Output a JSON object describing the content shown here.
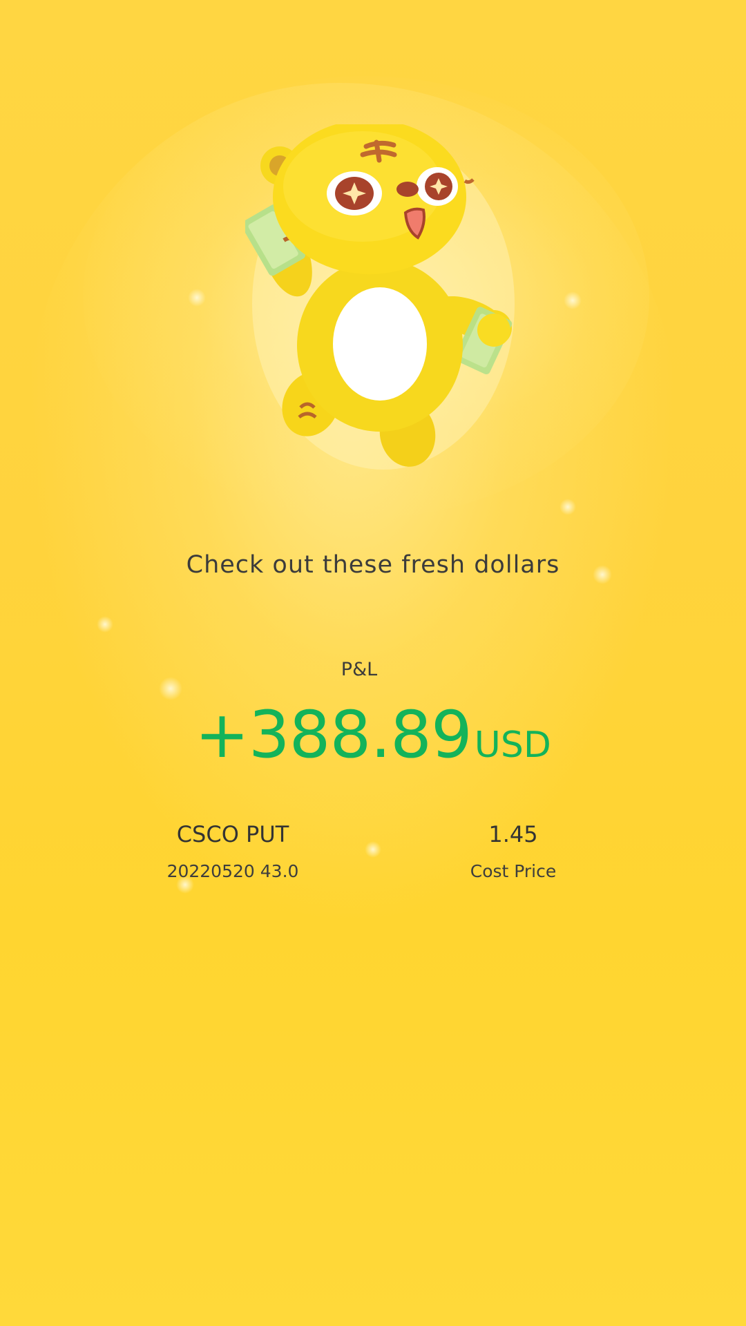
{
  "headline": "Check out these fresh dollars",
  "pnl": {
    "label": "P&L",
    "value": "+388.89",
    "unit": "USD"
  },
  "position": {
    "symbol": "CSCO PUT",
    "contract": "20220520 43.0",
    "cost_value": "1.45",
    "cost_label": "Cost Price"
  },
  "mascot": {
    "icon": "tiger-mascot-with-cash-icon"
  },
  "colors": {
    "background": "#ffd43c",
    "profit_green": "#13b35a",
    "text_dark": "#3b3b3b"
  }
}
